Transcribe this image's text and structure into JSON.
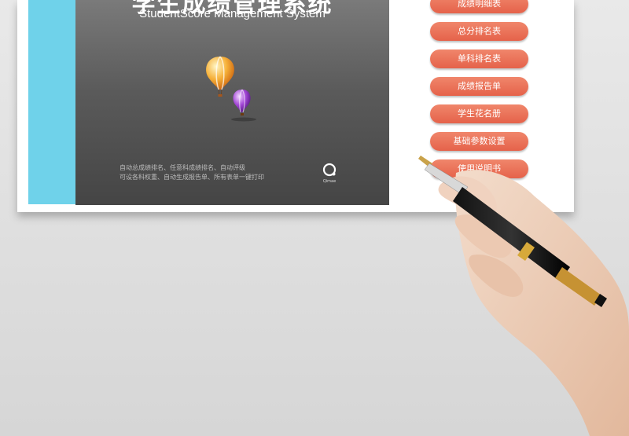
{
  "header": {
    "title_cn": "学生成绩管理系统",
    "subtitle": "StudentScore Management System"
  },
  "description": {
    "line1": "自动总成绩排名、任意科成绩排名、自动评级",
    "line2": "可设各科权重、自动生成报告单、所有表单一键打印"
  },
  "logo": {
    "text": "Qimae",
    "icon": "q-logo-icon"
  },
  "menu": {
    "items": [
      {
        "label": "成绩明细表"
      },
      {
        "label": "总分排名表"
      },
      {
        "label": "单科排名表"
      },
      {
        "label": "成绩报告单"
      },
      {
        "label": "学生花名册"
      },
      {
        "label": "基础参数设置"
      },
      {
        "label": "使用说明书"
      }
    ]
  },
  "colors": {
    "accent": "#e8684f",
    "band": "#6fd2ea",
    "panel": "#555555"
  }
}
